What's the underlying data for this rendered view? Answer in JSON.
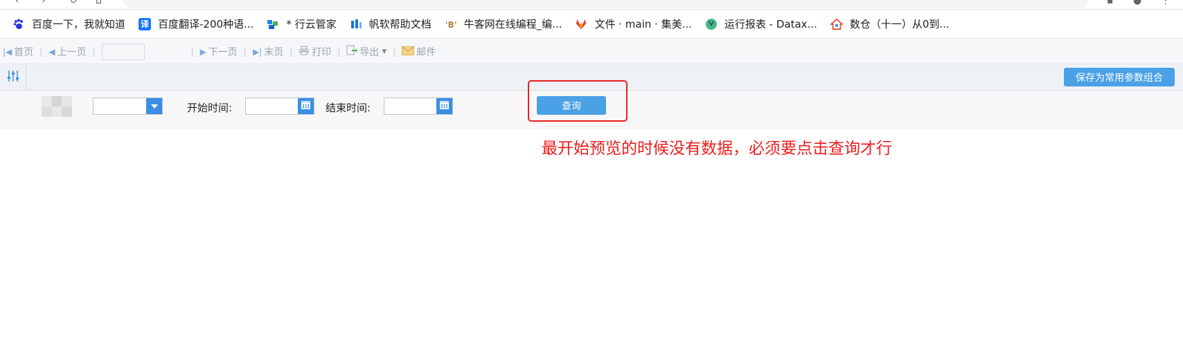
{
  "bookmarks": [
    {
      "label": "百度一下，我就知道",
      "icon": "baidu-paw-icon",
      "color": "#2932e1"
    },
    {
      "label": "百度翻译-200种语...",
      "icon": "translate-icon",
      "color": "#1677ff",
      "glyph": "译"
    },
    {
      "label": "* 行云管家",
      "icon": "cloud-manager-icon",
      "color": "#1e88e5"
    },
    {
      "label": "帆软帮助文档",
      "icon": "finereport-icon",
      "color": "#1a73e8"
    },
    {
      "label": "牛客网在线编程_编...",
      "icon": "nowcoder-icon",
      "color": "#b0864a"
    },
    {
      "label": "文件 · main · 集美...",
      "icon": "gitlab-icon",
      "color": "#e24329"
    },
    {
      "label": "运行报表 - Datax...",
      "icon": "vue-icon",
      "color": "#42b883"
    },
    {
      "label": "数仓（十一）从0到...",
      "icon": "house-icon",
      "color": "#e74c3c"
    }
  ],
  "pager": {
    "first": "首页",
    "prev": "上一页",
    "next": "下一页",
    "last": "末页",
    "print": "打印",
    "export": "导出",
    "mail": "邮件"
  },
  "param_bar": {
    "save_combo_label": "保存为常用参数组合"
  },
  "form": {
    "combo_value": "",
    "start_label": "开始时间:",
    "start_value": "",
    "end_label": "结束时间:",
    "end_value": "",
    "query_label": "查询"
  },
  "annotation": {
    "text": "最开始预览的时候没有数据，必须要点击查询才行",
    "color": "#ee1c1c"
  }
}
